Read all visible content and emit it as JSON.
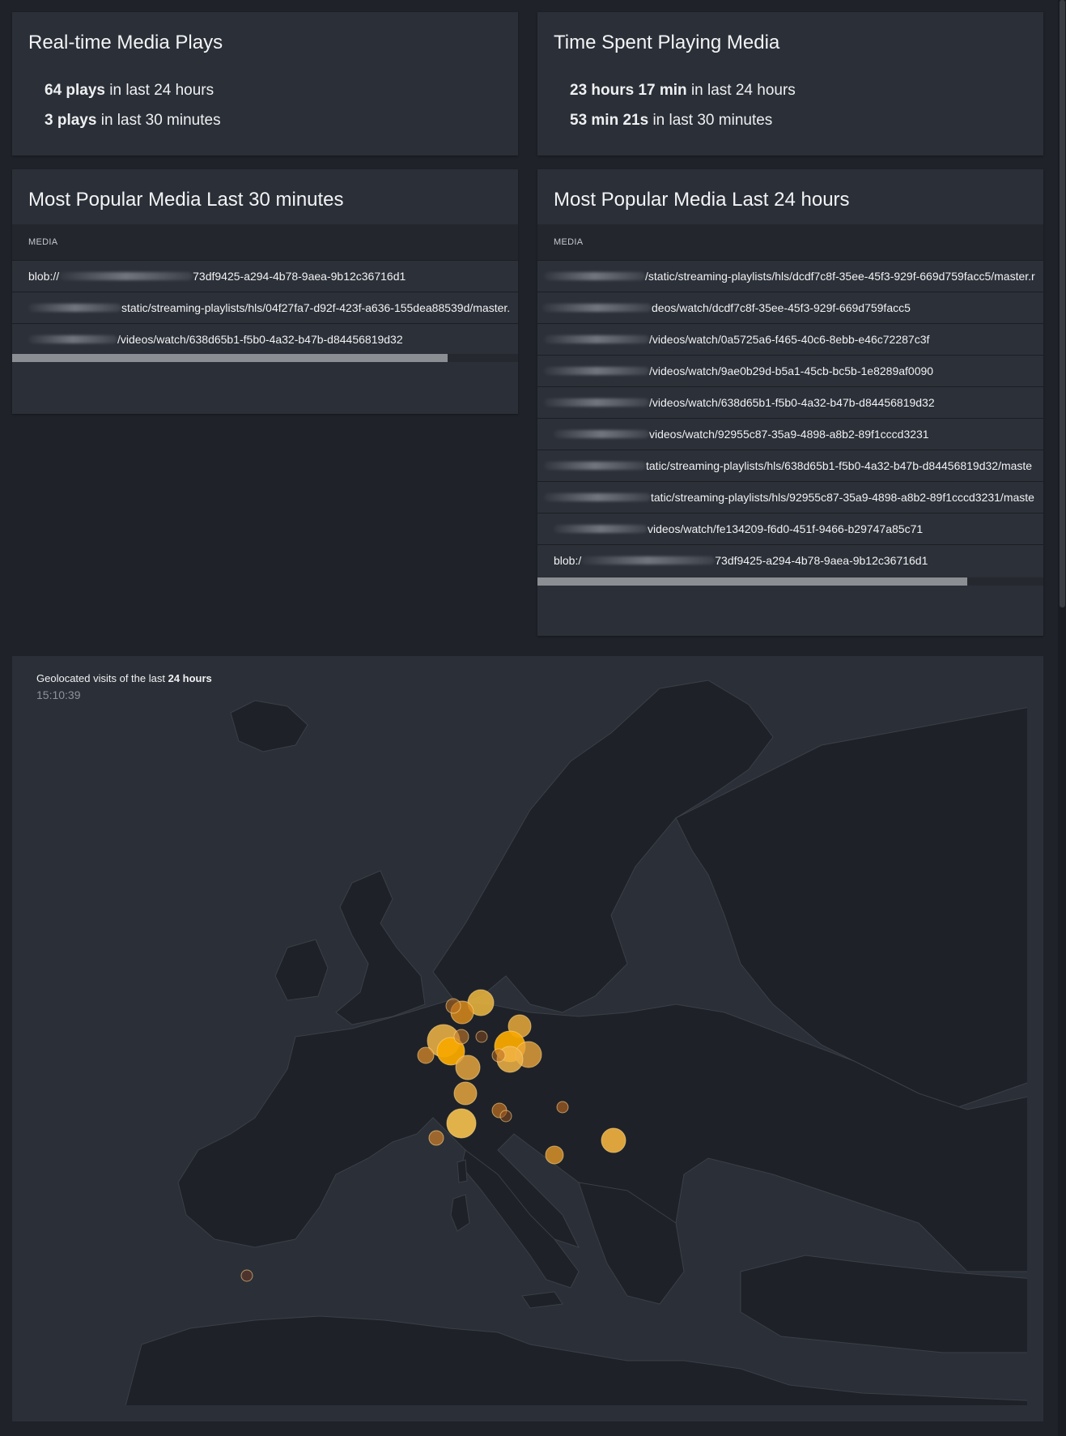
{
  "realtime": {
    "title": "Real-time Media Plays",
    "line1_bold": "64 plays",
    "line1_rest": " in last 24 hours",
    "line2_bold": "3 plays",
    "line2_rest": " in last 30 minutes"
  },
  "timespent": {
    "title": "Time Spent Playing Media",
    "line1_bold": "23 hours 17 min",
    "line1_rest": " in last 24 hours",
    "line2_bold": "53 min 21s",
    "line2_rest": " in last 30 minutes"
  },
  "popular30": {
    "title": "Most Popular Media Last 30 minutes",
    "column": "MEDIA",
    "rows": [
      {
        "prefix": "blob://",
        "text": "73df9425-a294-4b78-9aea-9b12c36716d1"
      },
      {
        "prefix": "",
        "text": "static/streaming-playlists/hls/04f27fa7-d92f-423f-a636-155dea88539d/master."
      },
      {
        "prefix": "",
        "text": "/videos/watch/638d65b1-f5b0-4a32-b47b-d84456819d32"
      }
    ],
    "scroll_fraction": 0.86
  },
  "popular24": {
    "title": "Most Popular Media Last 24 hours",
    "column": "MEDIA",
    "rows": [
      {
        "prefix": "",
        "text": "/static/streaming-playlists/hls/dcdf7c8f-35ee-45f3-929f-669d759facc5/master.r"
      },
      {
        "prefix": "",
        "text": "deos/watch/dcdf7c8f-35ee-45f3-929f-669d759facc5"
      },
      {
        "prefix": "",
        "text": "/videos/watch/0a5725a6-f465-40c6-8ebb-e46c72287c3f"
      },
      {
        "prefix": "",
        "text": "/videos/watch/9ae0b29d-b5a1-45cb-bc5b-1e8289af0090"
      },
      {
        "prefix": "",
        "text": "/videos/watch/638d65b1-f5b0-4a32-b47b-d84456819d32"
      },
      {
        "prefix": "",
        "text": "videos/watch/92955c87-35a9-4898-a8b2-89f1cccd3231"
      },
      {
        "prefix": "",
        "text": "tatic/streaming-playlists/hls/638d65b1-f5b0-4a32-b47b-d84456819d32/maste"
      },
      {
        "prefix": "",
        "text": "tatic/streaming-playlists/hls/92955c87-35a9-4898-a8b2-89f1cccd3231/maste"
      },
      {
        "prefix": "",
        "text": "videos/watch/fe134209-f6d0-451f-9466-b29747a85c71"
      },
      {
        "prefix": "blob:/",
        "text": "73df9425-a294-4b78-9aea-9b12c36716d1"
      }
    ],
    "scroll_fraction": 0.85
  },
  "map": {
    "title_prefix": "Geolocated visits of the last ",
    "title_bold": "24 hours",
    "time": "15:10:39",
    "colors": {
      "water": "#2b2f37",
      "land": "#1e2127",
      "border": "#3b3f47",
      "bubble": "#f5a300"
    }
  }
}
